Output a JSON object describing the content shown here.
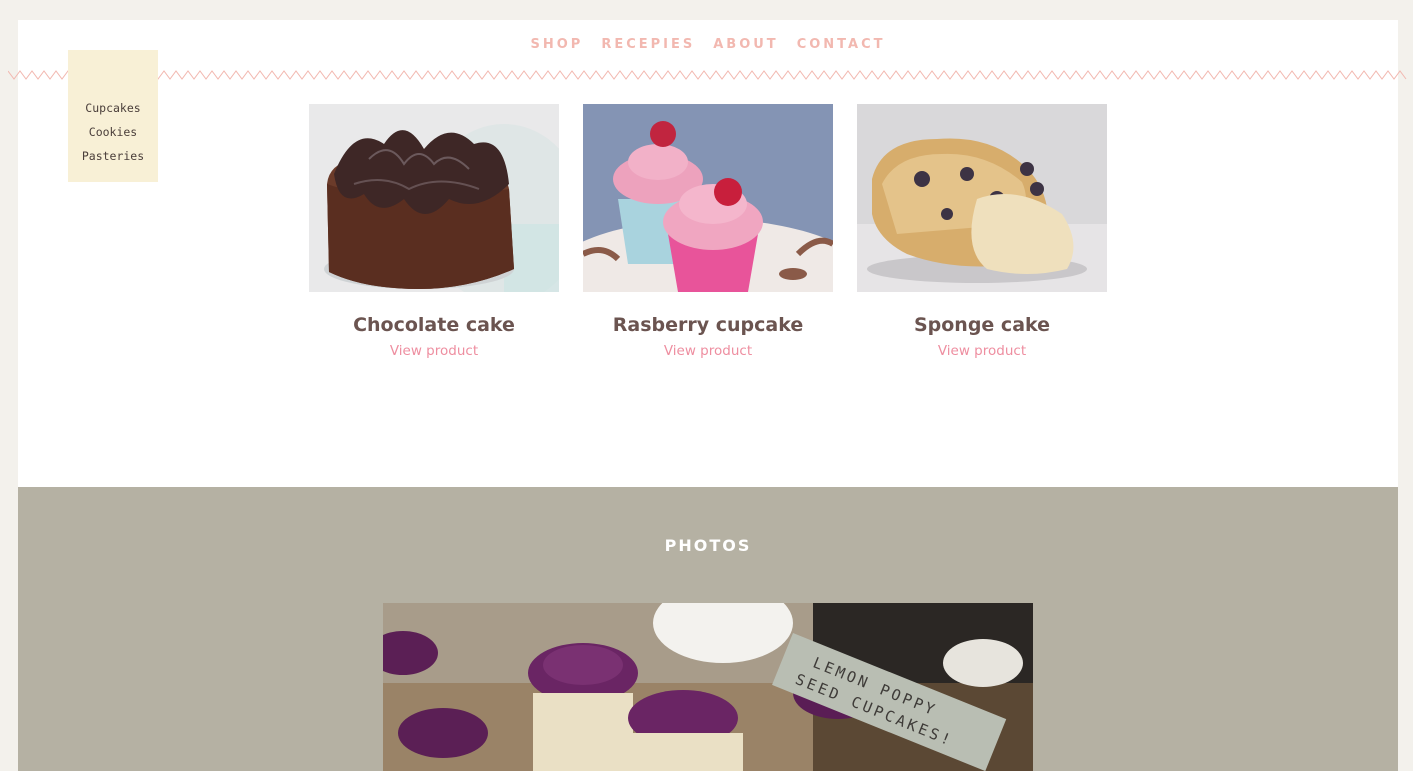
{
  "nav": {
    "items": [
      "SHOP",
      "RECEPIES",
      "ABOUT",
      "CONTACT"
    ]
  },
  "sidebar": {
    "items": [
      "Cupcakes",
      "Cookies",
      "Pasteries"
    ]
  },
  "products": [
    {
      "name": "Chocolate cake",
      "link": "View product"
    },
    {
      "name": "Rasberry cupcake",
      "link": "View product"
    },
    {
      "name": "Sponge cake",
      "link": "View product"
    }
  ],
  "photos": {
    "title": "PHOTOS",
    "tape_text_line1": "LEMON POPPY",
    "tape_text_line2": "SEED CUPCAKES!"
  },
  "colors": {
    "nav": "#f2b8b0",
    "accent_link": "#ee8ea0",
    "sidebar_bg": "#f8f0d6",
    "band_bg": "#b5b1a3",
    "product_title": "#6b5450"
  }
}
